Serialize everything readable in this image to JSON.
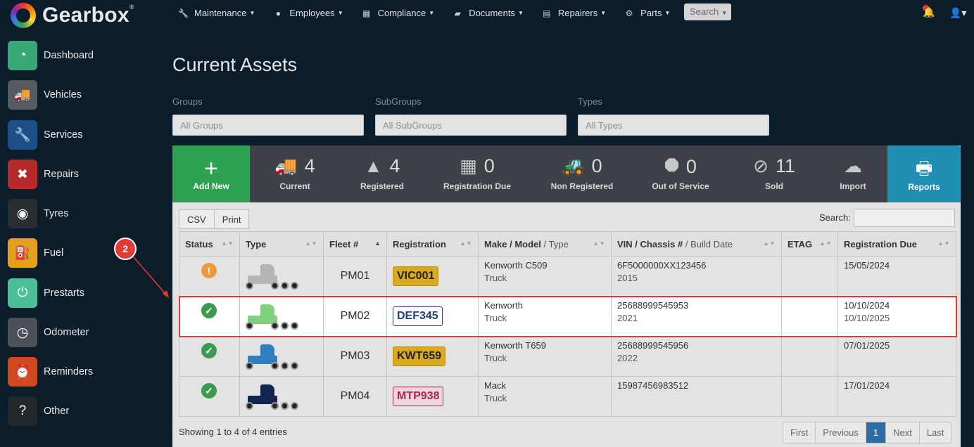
{
  "app": {
    "name": "Gearbox"
  },
  "nav": [
    {
      "label": "Maintenance",
      "icon": "wrench-icon"
    },
    {
      "label": "Employees",
      "icon": "person-icon"
    },
    {
      "label": "Compliance",
      "icon": "calendar-icon"
    },
    {
      "label": "Documents",
      "icon": "folder-icon"
    },
    {
      "label": "Repairers",
      "icon": "contact-card-icon"
    },
    {
      "label": "Parts",
      "icon": "gear-icon"
    }
  ],
  "search_button": "Search",
  "sidebar": [
    {
      "label": "Dashboard",
      "icon": "gauge-icon",
      "color": "#3aa876"
    },
    {
      "label": "Vehicles",
      "icon": "truck-icon",
      "color": "#575b61"
    },
    {
      "label": "Services",
      "icon": "wrench-icon",
      "color": "#1c4f8a"
    },
    {
      "label": "Repairs",
      "icon": "tools-icon",
      "color": "#b42a2a"
    },
    {
      "label": "Tyres",
      "icon": "tyre-icon",
      "color": "#2a2e33"
    },
    {
      "label": "Fuel",
      "icon": "fuel-icon",
      "color": "#e3a21a"
    },
    {
      "label": "Prestarts",
      "icon": "power-icon",
      "color": "#4bbf9a"
    },
    {
      "label": "Odometer",
      "icon": "odometer-icon",
      "color": "#4d5157"
    },
    {
      "label": "Reminders",
      "icon": "alarm-clock-icon",
      "color": "#cf4a1e"
    },
    {
      "label": "Other",
      "icon": "question-icon",
      "color": "#23272c"
    }
  ],
  "page_title": "Current Assets",
  "filters": [
    {
      "label": "Groups",
      "value": "All Groups"
    },
    {
      "label": "SubGroups",
      "value": "All SubGroups"
    },
    {
      "label": "Types",
      "value": "All Types"
    }
  ],
  "stats": {
    "add_new": "Add New",
    "current": {
      "count": "4",
      "label": "Current"
    },
    "registered": {
      "count": "4",
      "label": "Registered"
    },
    "registration_due": {
      "count": "0",
      "label": "Registration Due"
    },
    "non_registered": {
      "count": "0",
      "label": "Non Registered"
    },
    "out_of_service": {
      "count": "0",
      "label": "Out of Service"
    },
    "sold": {
      "count": "11",
      "label": "Sold"
    },
    "import": "Import",
    "reports": "Reports"
  },
  "table_tools": {
    "csv": "CSV",
    "print": "Print",
    "search_label": "Search:"
  },
  "columns": {
    "status": "Status",
    "type": "Type",
    "fleet": "Fleet #",
    "registration": "Registration",
    "make": "Make / Model",
    "make_sub": "/ Type",
    "vin": "VIN / Chassis #",
    "vin_sub": "/ Build Date",
    "etag": "ETAG",
    "due": "Registration Due"
  },
  "rows": [
    {
      "status": "warning",
      "truck_color": "#b5b5b5",
      "fleet": "PM01",
      "rego": "VIC001",
      "plate": "yellow",
      "make": "Kenworth C509",
      "type": "Truck",
      "vin": "6F5000000XX123456",
      "build": "2015",
      "etag": "",
      "due": "15/05/2024",
      "due2": ""
    },
    {
      "status": "ok",
      "truck_color": "#7fd07f",
      "fleet": "PM02",
      "rego": "DEF345",
      "plate": "white",
      "make": "Kenworth",
      "type": "Truck",
      "vin": "25688999545953",
      "build": "2021",
      "etag": "",
      "due": "10/10/2024",
      "due2": "10/10/2025"
    },
    {
      "status": "ok",
      "truck_color": "#2f7fc0",
      "fleet": "PM03",
      "rego": "KWT659",
      "plate": "yellow",
      "make": "Kenworth T659",
      "type": "Truck",
      "vin": "25688999545956",
      "build": "2022",
      "etag": "",
      "due": "07/01/2025",
      "due2": ""
    },
    {
      "status": "ok",
      "truck_color": "#10254f",
      "fleet": "PM04",
      "rego": "MTP938",
      "plate": "red",
      "make": "Mack",
      "type": "Truck",
      "vin": "15987456983512",
      "build": "",
      "etag": "",
      "due": "17/01/2024",
      "due2": ""
    }
  ],
  "footer_info": "Showing 1 to 4 of 4 entries",
  "pagination": {
    "first": "First",
    "previous": "Previous",
    "current": "1",
    "next": "Next",
    "last": "Last"
  },
  "annotation": {
    "marker": "2"
  }
}
